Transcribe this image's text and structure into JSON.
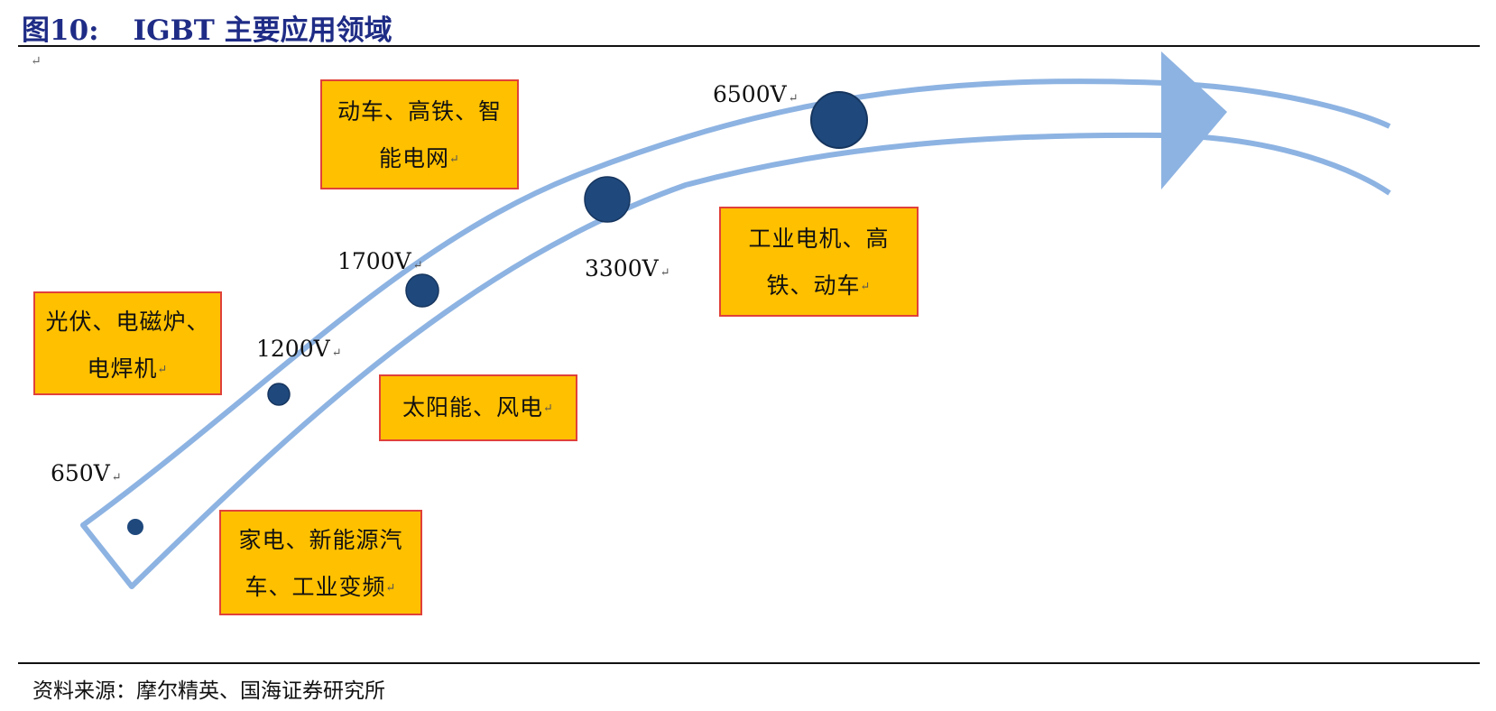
{
  "figure": {
    "number": "图10:",
    "title": "IGBT 主要应用领域"
  },
  "paragraph_mark": "↵",
  "voltages": [
    {
      "id": "v650",
      "label": "650V"
    },
    {
      "id": "v1200",
      "label": "1200V"
    },
    {
      "id": "v1700",
      "label": "1700V"
    },
    {
      "id": "v3300",
      "label": "3300V"
    },
    {
      "id": "v6500",
      "label": "6500V"
    }
  ],
  "applications": [
    {
      "id": "app-home",
      "line1": "家电、新能源汽",
      "line2": "车、工业变频"
    },
    {
      "id": "app-pv",
      "line1": "光伏、电磁炉、",
      "line2": "电焊机"
    },
    {
      "id": "app-solar",
      "line1": "太阳能、风电"
    },
    {
      "id": "app-rail",
      "line1": "动车、高铁、智",
      "line2": "能电网"
    },
    {
      "id": "app-motor",
      "line1": "工业电机、高",
      "line2": "铁、动车"
    }
  ],
  "colors": {
    "arrow_stroke": "#8db3e2",
    "dot_fill": "#1f497d",
    "box_fill": "#ffc000",
    "box_border": "#e0413a",
    "title": "#1f2c86"
  },
  "source": "资料来源：摩尔精英、国海证券研究所"
}
